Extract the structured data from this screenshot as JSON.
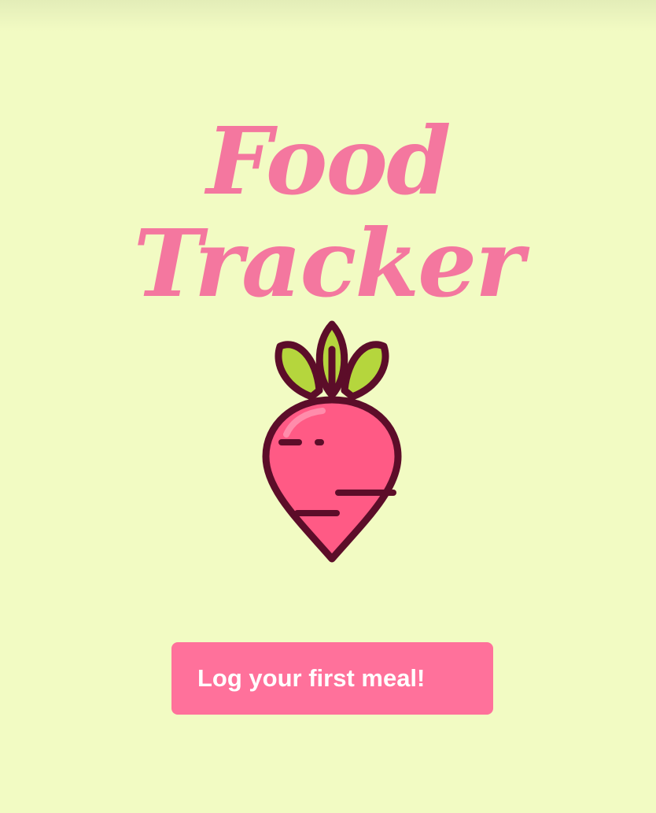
{
  "app": {
    "title": "Food Tracker"
  },
  "mascot": {
    "icon": "radish-icon"
  },
  "actions": {
    "log_first_meal_label": "Log your first meal!"
  },
  "colors": {
    "background": "#f2fbc3",
    "title": "#f4779f",
    "button": "#ff719b",
    "button_text": "#ffffff",
    "radish_body": "#ff5a85",
    "radish_leaves": "#b5d63d",
    "outline": "#5c0d29"
  }
}
